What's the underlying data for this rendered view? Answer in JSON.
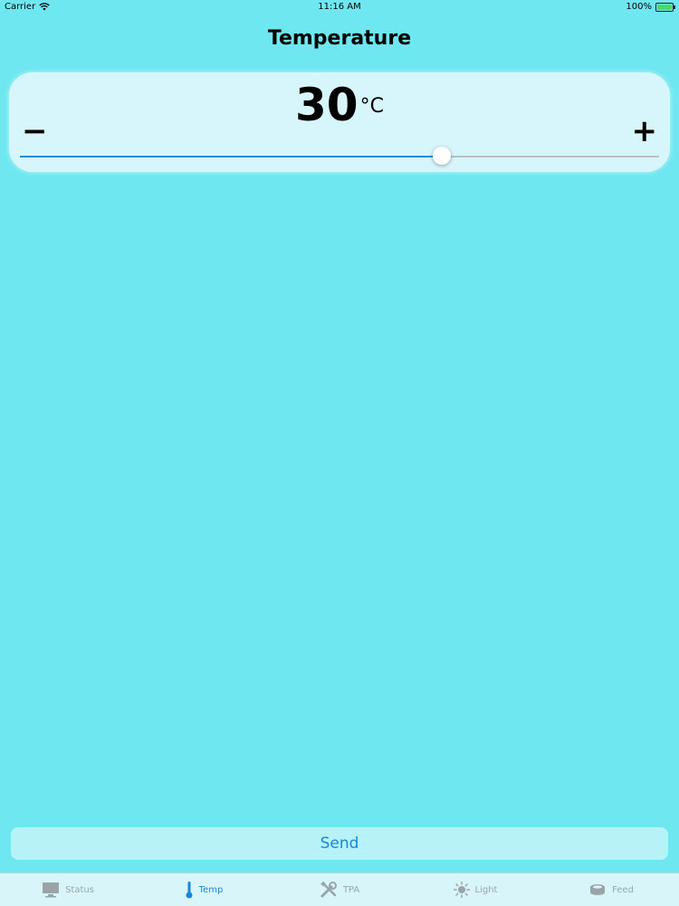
{
  "status_bar": {
    "carrier": "Carrier",
    "time": "11:16 AM",
    "battery": "100%",
    "icons": [
      "wifi-icon",
      "battery-icon"
    ]
  },
  "title": "Temperature",
  "temperature": {
    "value": "30",
    "unit": "°C",
    "minus_label": "−",
    "plus_label": "+",
    "slider_fraction": 0.66
  },
  "send_label": "Send",
  "tabs": [
    {
      "label": "Status",
      "icon": "monitor-icon",
      "active": false
    },
    {
      "label": "Temp",
      "icon": "thermometer-icon",
      "active": true
    },
    {
      "label": "TPA",
      "icon": "tools-icon",
      "active": false
    },
    {
      "label": "Light",
      "icon": "sun-icon",
      "active": false
    },
    {
      "label": "Feed",
      "icon": "feeder-icon",
      "active": false
    }
  ],
  "colors": {
    "background": "#6fe7f0",
    "card": "#d6f6fb",
    "accent": "#1a86d6",
    "inactive_tab": "#9aa4a8"
  }
}
